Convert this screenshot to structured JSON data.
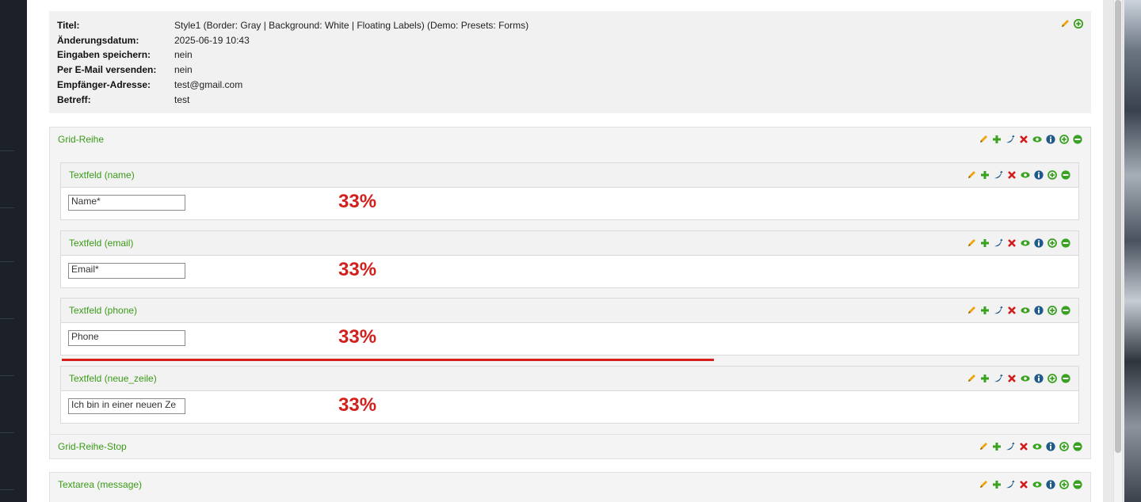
{
  "info": {
    "rows": [
      {
        "key": "Titel:",
        "value": "Style1 (Border: Gray | Background: White | Floating Labels) (Demo: Presets: Forms)"
      },
      {
        "key": "Änderungsdatum:",
        "value": "2025-06-19 10:43"
      },
      {
        "key": "Eingaben speichern:",
        "value": "nein"
      },
      {
        "key": "Per E-Mail versenden:",
        "value": "nein"
      },
      {
        "key": "Empfänger-Adresse:",
        "value": "test@gmail.com"
      },
      {
        "key": "Betreff:",
        "value": "test"
      }
    ],
    "icons": [
      "pencil-icon",
      "plus-circle-icon"
    ]
  },
  "grid_row": {
    "title": "Grid-Reihe"
  },
  "fields": [
    {
      "title": "Textfeld (name)",
      "input_value": "Name*",
      "percent": "33%"
    },
    {
      "title": "Textfeld (email)",
      "input_value": "Email*",
      "percent": "33%"
    },
    {
      "title": "Textfeld (phone)",
      "input_value": "Phone",
      "percent": "33%"
    },
    {
      "title": "Textfeld (neue_zeile)",
      "input_value": "Ich bin in einer neuen Ze",
      "percent": "33%"
    }
  ],
  "grid_row_stop": {
    "title": "Grid-Reihe-Stop"
  },
  "textarea": {
    "title": "Textarea (message)"
  },
  "toolbar_icons": [
    "pencil-icon",
    "plus-icon",
    "move-icon",
    "delete-icon",
    "eye-icon",
    "info-icon",
    "plus-circle-icon",
    "minus-circle-icon"
  ],
  "colors": {
    "title_green": "#3a9a17",
    "percent_red": "#d2201d",
    "pencil_orange": "#f0a30a",
    "green": "#3aa220",
    "blue": "#1f5a8a",
    "red": "#d21c1c"
  }
}
